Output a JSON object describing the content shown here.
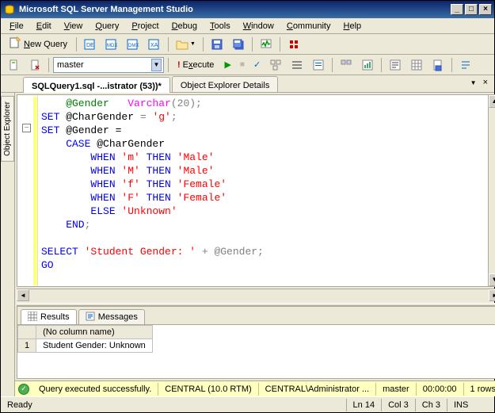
{
  "window": {
    "title": "Microsoft SQL Server Management Studio"
  },
  "menu": {
    "file": "File",
    "edit": "Edit",
    "view": "View",
    "query": "Query",
    "project": "Project",
    "debug": "Debug",
    "tools": "Tools",
    "window": "Window",
    "community": "Community",
    "help": "Help"
  },
  "toolbar1": {
    "new_query": "New Query"
  },
  "toolbar2": {
    "database_selected": "master",
    "execute": "Execute"
  },
  "sidebar": {
    "object_explorer": "Object Explorer"
  },
  "tabs": {
    "tab1": "SQLQuery1.sql -...istrator (53))*",
    "tab2": "Object Explorer Details"
  },
  "code": {
    "l1_ident": "    @Gender   ",
    "l1_type": "Varchar",
    "l1_num": "20",
    "l2_set": "SET",
    "l2_var": " @CharGender ",
    "l2_str": "'g'",
    "l3_set": "SET",
    "l3_rest": " @Gender =",
    "l4_case": "    CASE",
    "l4_rest": " @CharGender",
    "l5_when": "        WHEN ",
    "l5_s1": "'m'",
    "l5_then": " THEN ",
    "l5_s2": "'Male'",
    "l6_when": "        WHEN ",
    "l6_s1": "'M'",
    "l6_then": " THEN ",
    "l6_s2": "'Male'",
    "l7_when": "        WHEN ",
    "l7_s1": "'f'",
    "l7_then": " THEN ",
    "l7_s2": "'Female'",
    "l8_when": "        WHEN ",
    "l8_s1": "'F'",
    "l8_then": " THEN ",
    "l8_s2": "'Female'",
    "l9_else": "        ELSE ",
    "l9_s": "'Unknown'",
    "l10_end": "    END",
    "l11": "",
    "l12_sel": "SELECT ",
    "l12_s": "'Student Gender: '",
    "l12_rest": " + @Gender;",
    "l13_go": "GO"
  },
  "results": {
    "tab_results": "Results",
    "tab_messages": "Messages",
    "col1": "(No column name)",
    "row1_num": "1",
    "row1_val": "Student Gender: Unknown"
  },
  "status_yellow": {
    "message": "Query executed successfully.",
    "server": "CENTRAL (10.0 RTM)",
    "user": "CENTRAL\\Administrator ...",
    "db": "master",
    "time": "00:00:00",
    "rows": "1 rows"
  },
  "status": {
    "ready": "Ready",
    "ln": "Ln 14",
    "col": "Col 3",
    "ch": "Ch 3",
    "ins": "INS"
  }
}
